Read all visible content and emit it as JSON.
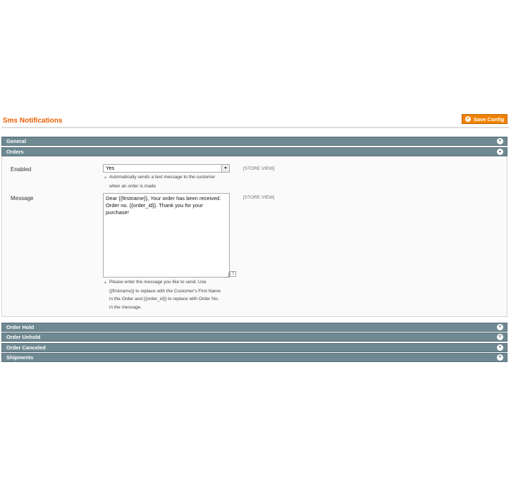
{
  "page": {
    "title": "Sms Notifications",
    "save_label": "Save Config",
    "accent_color": "#eb5e00",
    "button_color": "#f18200",
    "section_color": "#6f8992"
  },
  "sections": {
    "general": {
      "label": "General",
      "state": "collapsed"
    },
    "orders": {
      "label": "Orders",
      "state": "expanded"
    },
    "order_hold": {
      "label": "Order Hold",
      "state": "collapsed"
    },
    "order_unhold": {
      "label": "Order Unhold",
      "state": "collapsed"
    },
    "order_canceled": {
      "label": "Order Canceled",
      "state": "collapsed"
    },
    "shipments": {
      "label": "Shipments",
      "state": "collapsed"
    }
  },
  "orders_form": {
    "enabled": {
      "label": "Enabled",
      "value": "Yes",
      "scope": "[STORE VIEW]",
      "note_line1": "Automatically sends a text message to the customer",
      "note_line2": "when an order is made"
    },
    "message": {
      "label": "Message",
      "value": "Dear {{firstname}}, Your order has been received. Order no. {{order_id}}. Thank you for your purchase!",
      "scope": "[STORE VIEW]",
      "help_label": "?",
      "note_line1": "Please enter the message you like to send. Use",
      "note_line2": "{{firstname}} to replace with the Customer's First Name",
      "note_line3": "in the Order and {{order_id}} to replace with Order No.",
      "note_line4": "in the message."
    }
  },
  "icons": {
    "expand": "▼",
    "collapse": "▲",
    "save": "✔",
    "note_arrow": "▲"
  }
}
